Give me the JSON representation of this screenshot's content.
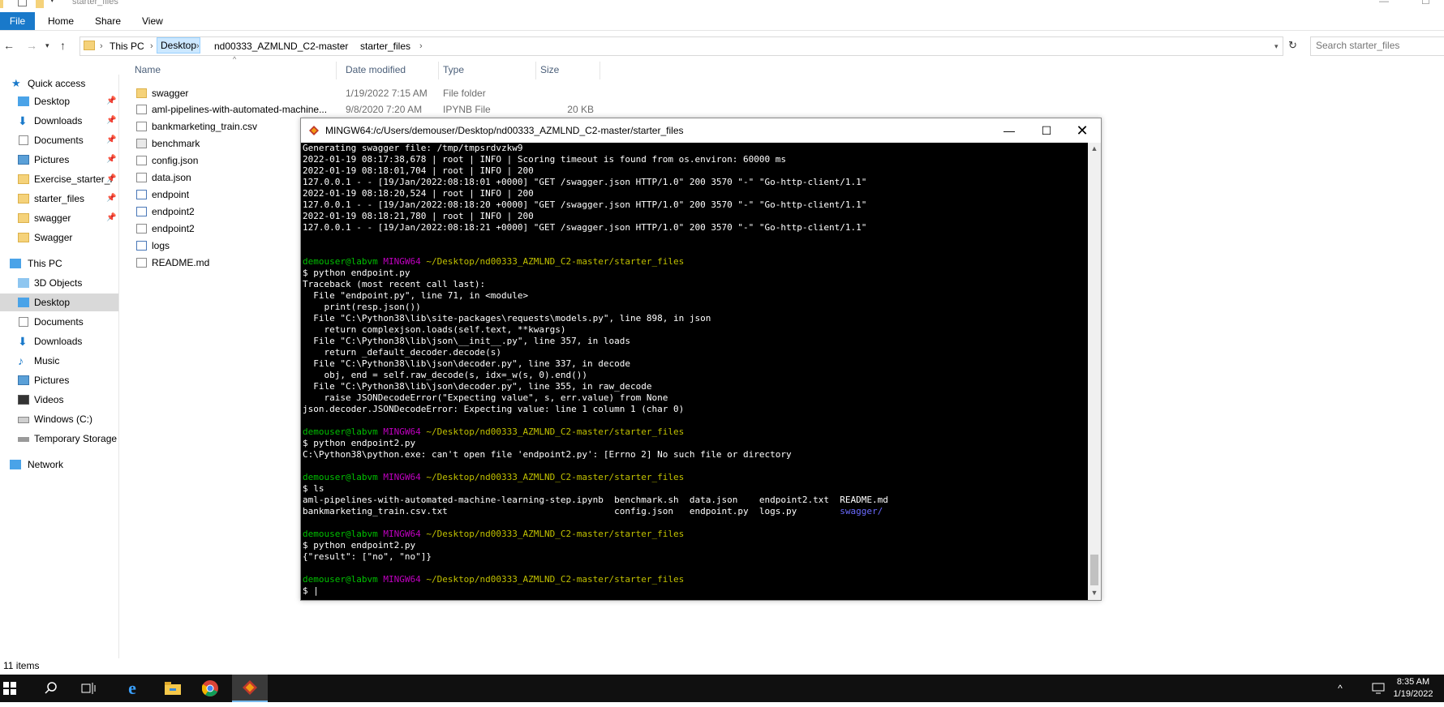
{
  "window": {
    "title": "starter_files"
  },
  "ribbon": {
    "tabs": [
      "File",
      "Home",
      "Share",
      "View"
    ]
  },
  "address": {
    "crumbs": [
      "This PC",
      "Desktop",
      "nd00333_AZMLND_C2-master",
      "starter_files"
    ],
    "search_placeholder": "Search starter_files"
  },
  "nav": {
    "quick_access": "Quick access",
    "pinned": [
      "Desktop",
      "Downloads",
      "Documents",
      "Pictures",
      "Exercise_starter_f",
      "starter_files",
      "swagger"
    ],
    "unpinned": [
      "Swagger"
    ],
    "this_pc": "This PC",
    "pc_items": [
      "3D Objects",
      "Desktop",
      "Documents",
      "Downloads",
      "Music",
      "Pictures",
      "Videos",
      "Windows (C:)",
      "Temporary Storage"
    ],
    "network": "Network"
  },
  "filelist": {
    "columns": [
      "Name",
      "Date modified",
      "Type",
      "Size"
    ],
    "rows": [
      {
        "name": "swagger",
        "date": "1/19/2022 7:15 AM",
        "type": "File folder",
        "size": ""
      },
      {
        "name": "aml-pipelines-with-automated-machine...",
        "date": "9/8/2020 7:20 AM",
        "type": "IPYNB File",
        "size": "20 KB"
      },
      {
        "name": "bankmarketing_train.csv",
        "date": "",
        "type": "",
        "size": ""
      },
      {
        "name": "benchmark",
        "date": "",
        "type": "",
        "size": ""
      },
      {
        "name": "config.json",
        "date": "",
        "type": "",
        "size": ""
      },
      {
        "name": "data.json",
        "date": "",
        "type": "",
        "size": ""
      },
      {
        "name": "endpoint",
        "date": "",
        "type": "",
        "size": ""
      },
      {
        "name": "endpoint2",
        "date": "",
        "type": "",
        "size": ""
      },
      {
        "name": "endpoint2",
        "date": "",
        "type": "",
        "size": ""
      },
      {
        "name": "logs",
        "date": "",
        "type": "",
        "size": ""
      },
      {
        "name": "README.md",
        "date": "",
        "type": "",
        "size": ""
      }
    ]
  },
  "status": {
    "items": "11 items"
  },
  "terminal": {
    "title": "MINGW64:/c/Users/demouser/Desktop/nd00333_AZMLND_C2-master/starter_files",
    "prompt": {
      "user": "demouser@labvm",
      "host": "MINGW64",
      "path": "~/Desktop/nd00333_AZMLND_C2-master/starter_files"
    },
    "lines": [
      "Generating swagger file: /tmp/tmpsrdvzkw9",
      "2022-01-19 08:17:38,678 | root | INFO | Scoring timeout is found from os.environ: 60000 ms",
      "2022-01-19 08:18:01,704 | root | INFO | 200",
      "127.0.0.1 - - [19/Jan/2022:08:18:01 +0000] \"GET /swagger.json HTTP/1.0\" 200 3570 \"-\" \"Go-http-client/1.1\"",
      "2022-01-19 08:18:20,524 | root | INFO | 200",
      "127.0.0.1 - - [19/Jan/2022:08:18:20 +0000] \"GET /swagger.json HTTP/1.0\" 200 3570 \"-\" \"Go-http-client/1.1\"",
      "2022-01-19 08:18:21,780 | root | INFO | 200",
      "127.0.0.1 - - [19/Jan/2022:08:18:21 +0000] \"GET /swagger.json HTTP/1.0\" 200 3570 \"-\" \"Go-http-client/1.1\"",
      "",
      "",
      "$P",
      "$ python endpoint.py",
      "Traceback (most recent call last):",
      "  File \"endpoint.py\", line 71, in <module>",
      "    print(resp.json())",
      "  File \"C:\\Python38\\lib\\site-packages\\requests\\models.py\", line 898, in json",
      "    return complexjson.loads(self.text, **kwargs)",
      "  File \"C:\\Python38\\lib\\json\\__init__.py\", line 357, in loads",
      "    return _default_decoder.decode(s)",
      "  File \"C:\\Python38\\lib\\json\\decoder.py\", line 337, in decode",
      "    obj, end = self.raw_decode(s, idx=_w(s, 0).end())",
      "  File \"C:\\Python38\\lib\\json\\decoder.py\", line 355, in raw_decode",
      "    raise JSONDecodeError(\"Expecting value\", s, err.value) from None",
      "json.decoder.JSONDecodeError: Expecting value: line 1 column 1 (char 0)",
      "",
      "$P",
      "$ python endpoint2.py",
      "C:\\Python38\\python.exe: can't open file 'endpoint2.py': [Errno 2] No such file or directory",
      "",
      "$P",
      "$ ls",
      "aml-pipelines-with-automated-machine-learning-step.ipynb  benchmark.sh  data.json    endpoint2.txt  README.md",
      "$LS2",
      "",
      "$P",
      "$ python endpoint2.py",
      "{\"result\": [\"no\", \"no\"]}",
      "",
      "$P",
      "$ |"
    ],
    "ls_line2": "bankmarketing_train.csv.txt                               config.json   endpoint.py  logs.py        ",
    "ls_dir": "swagger/"
  },
  "taskbar": {
    "time": "8:35 AM",
    "date": "1/19/2022"
  }
}
